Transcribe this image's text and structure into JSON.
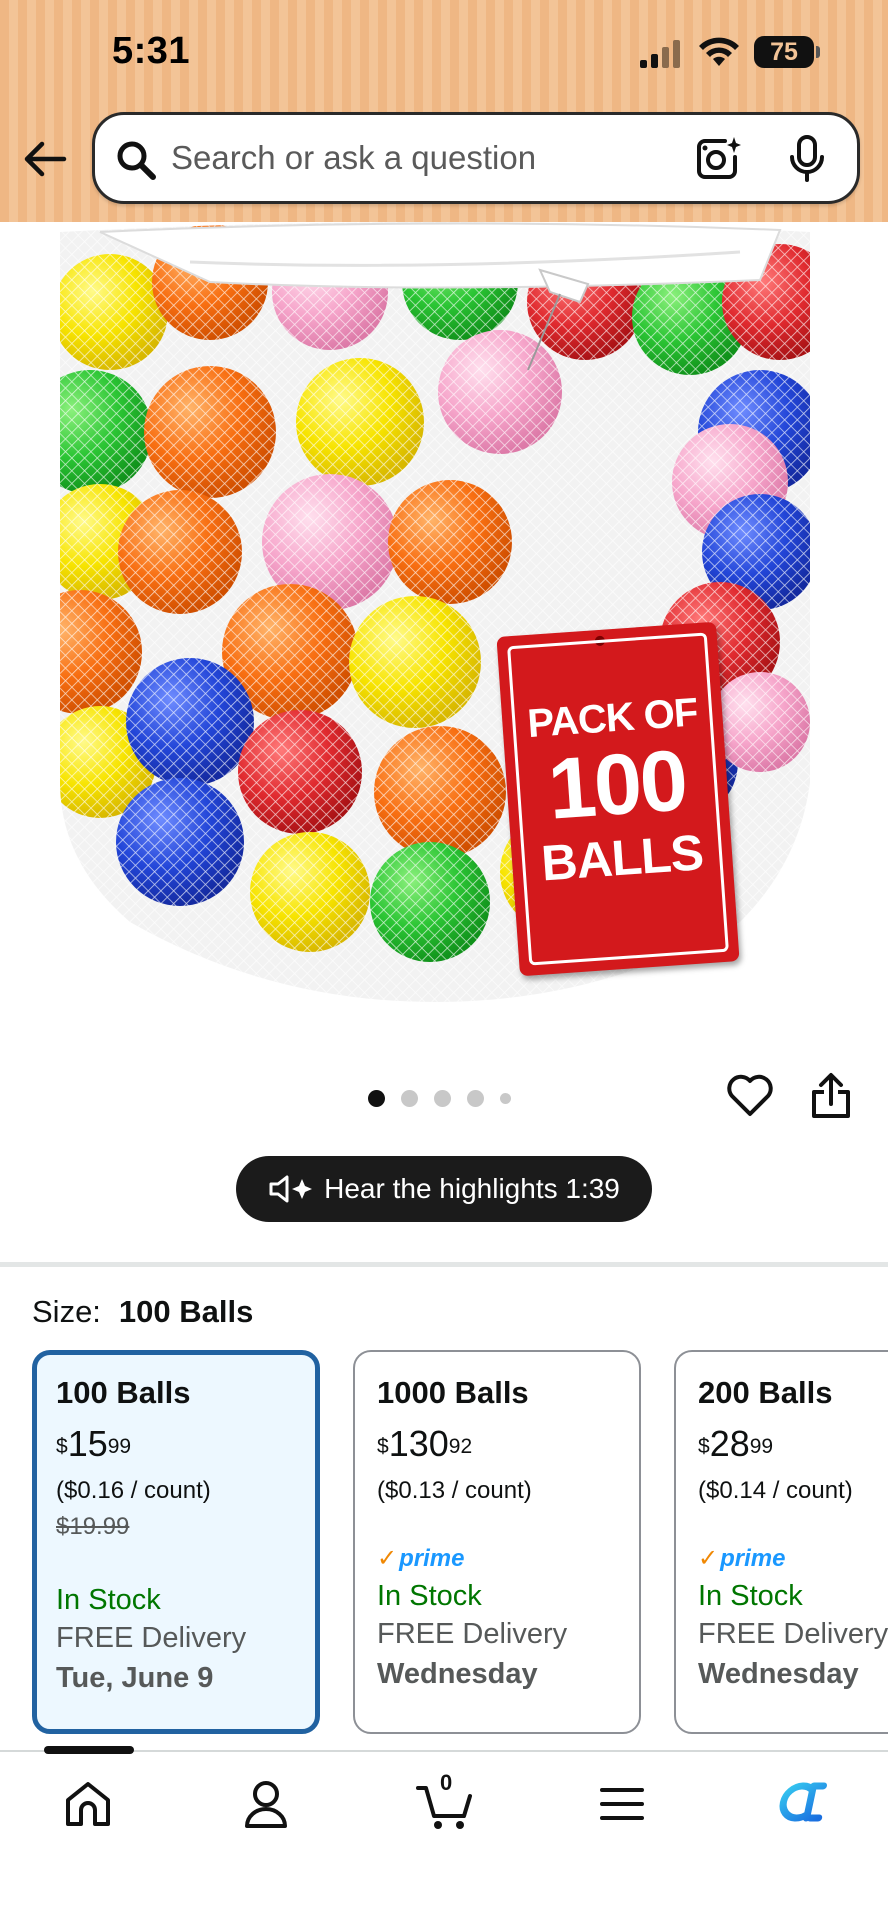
{
  "status_bar": {
    "time": "5:31",
    "battery": "75"
  },
  "search": {
    "placeholder": "Search or ask a question"
  },
  "product_image": {
    "tag_line1": "PACK OF",
    "tag_line2": "100",
    "tag_line3": "BALLS"
  },
  "carousel": {
    "image_count": 5,
    "active_index": 0
  },
  "highlights": {
    "label": "Hear the highlights 1:39"
  },
  "size": {
    "label": "Size:",
    "selected": "100 Balls"
  },
  "size_options": [
    {
      "title": "100 Balls",
      "price_symbol": "$",
      "price_whole": "15",
      "price_cents": "99",
      "unit_price": "($0.16 / count)",
      "list_price": "$19.99",
      "prime": false,
      "stock": "In Stock",
      "delivery": "FREE Delivery",
      "date": "Tue, June 9"
    },
    {
      "title": "1000 Balls",
      "price_symbol": "$",
      "price_whole": "130",
      "price_cents": "92",
      "unit_price": "($0.13 / count)",
      "list_price": "",
      "prime": true,
      "prime_label": "prime",
      "stock": "In Stock",
      "delivery": "FREE Delivery",
      "date": "Wednesday"
    },
    {
      "title": "200 Balls",
      "price_symbol": "$",
      "price_whole": "28",
      "price_cents": "99",
      "unit_price": "($0.14 / count)",
      "list_price": "",
      "prime": true,
      "prime_label": "prime",
      "stock": "In Stock",
      "delivery": "FREE Delivery",
      "date": "Wednesday"
    }
  ],
  "bottom_nav": {
    "cart_count": "0",
    "items": [
      "home-icon",
      "account-icon",
      "cart-icon",
      "menu-icon",
      "rufus-icon"
    ]
  },
  "colors": {
    "header_bg": "#efb784",
    "selected_border": "#2162a1",
    "selected_bg": "#edf8ff",
    "in_stock": "#007600",
    "prime_blue": "#1a98ff",
    "prime_check": "#f08804",
    "tag_red": "#d3191c"
  }
}
